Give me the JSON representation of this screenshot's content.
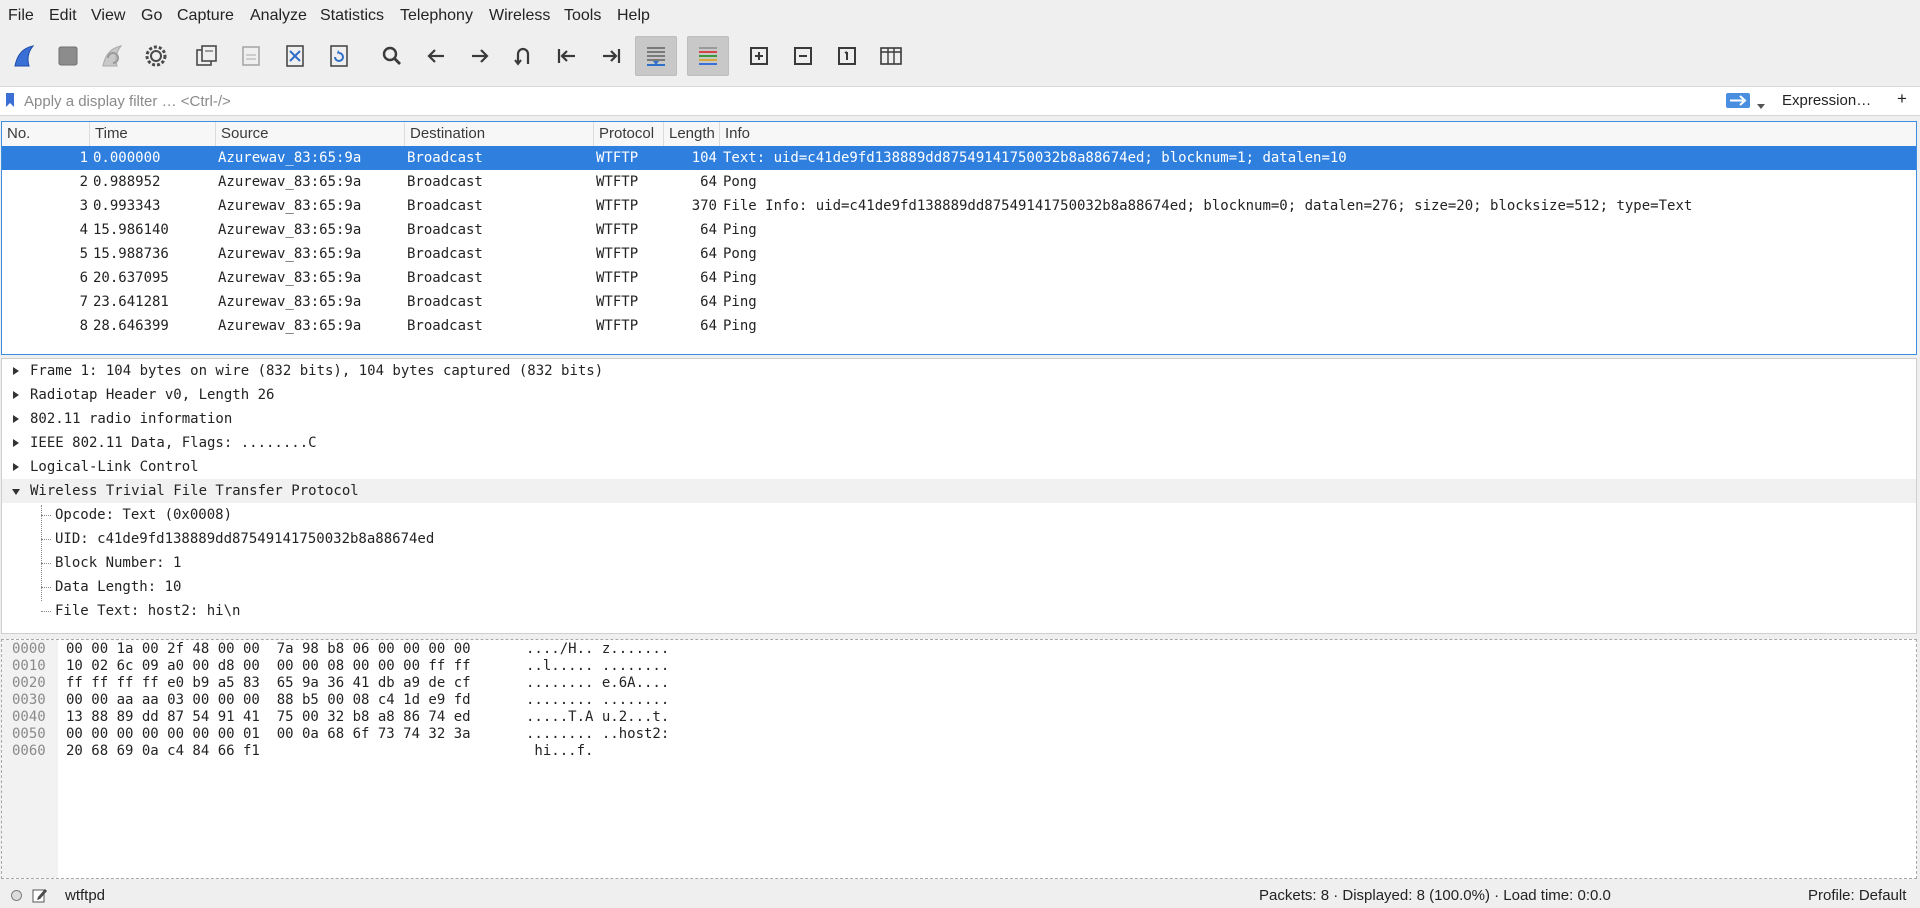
{
  "menu": [
    "File",
    "Edit",
    "View",
    "Go",
    "Capture",
    "Analyze",
    "Statistics",
    "Telephony",
    "Wireless",
    "Tools",
    "Help"
  ],
  "toolbar": {
    "icons": [
      "shark-fin-start-icon",
      "stop-square-icon",
      "shark-fin-restart-icon",
      "capture-options-gear-icon",
      "open-file-icon",
      "save-file-icon",
      "close-file-icon",
      "reload-file-icon",
      "search-icon",
      "go-back-icon",
      "go-forward-icon",
      "go-to-packet-icon",
      "go-first-icon",
      "go-last-icon",
      "autoscroll-icon",
      "colorize-icon",
      "zoom-in-icon",
      "zoom-out-icon",
      "zoom-normal-icon",
      "resize-columns-icon"
    ]
  },
  "filter": {
    "placeholder": "Apply a display filter … <Ctrl-/>",
    "expression_label": "Expression…",
    "plus_label": "+"
  },
  "packet_list": {
    "columns": [
      "No.",
      "Time",
      "Source",
      "Destination",
      "Protocol",
      "Length",
      "Info"
    ],
    "rows": [
      {
        "no": "1",
        "time": "0.000000",
        "source": "Azurewav_83:65:9a",
        "destination": "Broadcast",
        "protocol": "WTFTP",
        "length": "104",
        "info": "Text: uid=c41de9fd138889dd87549141750032b8a88674ed; blocknum=1; datalen=10"
      },
      {
        "no": "2",
        "time": "0.988952",
        "source": "Azurewav_83:65:9a",
        "destination": "Broadcast",
        "protocol": "WTFTP",
        "length": "64",
        "info": "Pong"
      },
      {
        "no": "3",
        "time": "0.993343",
        "source": "Azurewav_83:65:9a",
        "destination": "Broadcast",
        "protocol": "WTFTP",
        "length": "370",
        "info": "File Info: uid=c41de9fd138889dd87549141750032b8a88674ed; blocknum=0; datalen=276; size=20; blocksize=512; type=Text"
      },
      {
        "no": "4",
        "time": "15.986140",
        "source": "Azurewav_83:65:9a",
        "destination": "Broadcast",
        "protocol": "WTFTP",
        "length": "64",
        "info": "Ping"
      },
      {
        "no": "5",
        "time": "15.988736",
        "source": "Azurewav_83:65:9a",
        "destination": "Broadcast",
        "protocol": "WTFTP",
        "length": "64",
        "info": "Pong"
      },
      {
        "no": "6",
        "time": "20.637095",
        "source": "Azurewav_83:65:9a",
        "destination": "Broadcast",
        "protocol": "WTFTP",
        "length": "64",
        "info": "Ping"
      },
      {
        "no": "7",
        "time": "23.641281",
        "source": "Azurewav_83:65:9a",
        "destination": "Broadcast",
        "protocol": "WTFTP",
        "length": "64",
        "info": "Ping"
      },
      {
        "no": "8",
        "time": "28.646399",
        "source": "Azurewav_83:65:9a",
        "destination": "Broadcast",
        "protocol": "WTFTP",
        "length": "64",
        "info": "Ping"
      }
    ]
  },
  "details": {
    "items": [
      "Frame 1: 104 bytes on wire (832 bits), 104 bytes captured (832 bits)",
      "Radiotap Header v0, Length 26",
      "802.11 radio information",
      "IEEE 802.11 Data, Flags: ........C",
      "Logical-Link Control",
      "Wireless Trivial File Transfer Protocol"
    ],
    "children": [
      "Opcode: Text (0x0008)",
      "UID: c41de9fd138889dd87549141750032b8a88674ed",
      "Block Number: 1",
      "Data Length: 10",
      "File Text: host2: hi\\n"
    ]
  },
  "bytes": {
    "rows": [
      {
        "offset": "0000",
        "hex": "00 00 1a 00 2f 48 00 00  7a 98 b8 06 00 00 00 00",
        "ascii": "..../H.. z......."
      },
      {
        "offset": "0010",
        "hex": "10 02 6c 09 a0 00 d8 00  00 00 08 00 00 00 ff ff",
        "ascii": "..l..... ........"
      },
      {
        "offset": "0020",
        "hex": "ff ff ff ff e0 b9 a5 83  65 9a 36 41 db a9 de cf",
        "ascii": "........ e.6A...."
      },
      {
        "offset": "0030",
        "hex": "00 00 aa aa 03 00 00 00  88 b5 00 08 c4 1d e9 fd",
        "ascii": "........ ........"
      },
      {
        "offset": "0040",
        "hex": "13 88 89 dd 87 54 91 41  75 00 32 b8 a8 86 74 ed",
        "ascii": ".....T.A u.2...t."
      },
      {
        "offset": "0050",
        "hex": "00 00 00 00 00 00 00 01  00 0a 68 6f 73 74 32 3a",
        "ascii": "........ ..host2:"
      },
      {
        "offset": "0060",
        "hex": "20 68 69 0a c4 84 66 f1",
        "ascii": " hi...f."
      }
    ]
  },
  "status": {
    "file": "wtftpd",
    "packets": "Packets: 8 · Displayed: 8 (100.0%) · Load time: 0:0.0",
    "profile": "Profile: Default"
  },
  "colors": {
    "selection": "#2f7fdf",
    "focus_border": "#3e8ee0",
    "window_bg": "#efefef"
  }
}
